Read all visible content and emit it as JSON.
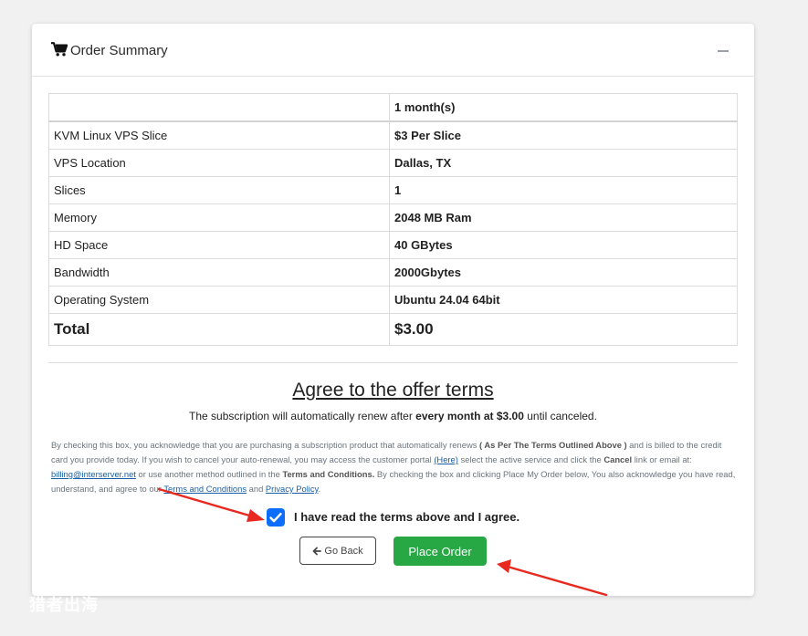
{
  "header": {
    "title": "Order Summary",
    "icon": "shopping-cart-icon"
  },
  "table": {
    "head": {
      "label": "",
      "value": "1 month(s)"
    },
    "rows": [
      {
        "label": "KVM Linux VPS Slice",
        "value": "$3 Per Slice"
      },
      {
        "label": "VPS Location",
        "value": "Dallas, TX"
      },
      {
        "label": "Slices",
        "value": "1"
      },
      {
        "label": "Memory",
        "value": "2048 MB Ram"
      },
      {
        "label": "HD Space",
        "value": "40 GBytes"
      },
      {
        "label": "Bandwidth",
        "value": "2000Gbytes"
      },
      {
        "label": "Operating System",
        "value": "Ubuntu 24.04 64bit"
      }
    ],
    "total": {
      "label": "Total",
      "value": "$3.00"
    }
  },
  "terms": {
    "title": "Agree to the offer terms",
    "renew_pre": "The subscription will automatically renew after ",
    "renew_bold": "every month at $3.00",
    "renew_post": " until canceled.",
    "legal_1": "By checking this box, you acknowledge that you are purchasing a subscription product that automatically renews ",
    "legal_b1": "( As Per The Terms Outlined Above )",
    "legal_2": " and is billed to the credit card you provide today. If you wish to cancel your auto-renewal, you may access the customer portal ",
    "legal_link_here": "(Here)",
    "legal_3": " select the active service and click the ",
    "legal_b2": "Cancel",
    "legal_4": " link or email at: ",
    "legal_link_email": "billing@interserver.net",
    "legal_5": " or use another method outlined in the ",
    "legal_b3": "Terms and Conditions.",
    "legal_6": " By checking the box and clicking Place My Order below, You also acknowledge you have read, understand, and agree to our ",
    "legal_link_terms": "Terms and Conditions",
    "legal_7": " and ",
    "legal_link_privacy": "Privacy Policy",
    "legal_8": "."
  },
  "agree": {
    "label": "I have read the terms above and I agree.",
    "checked": true
  },
  "buttons": {
    "back": "Go Back",
    "place": "Place Order"
  },
  "colors": {
    "accent": "#0d6efd",
    "success": "#28a745",
    "arrow": "#e8291f"
  },
  "watermark": "猎者出海"
}
